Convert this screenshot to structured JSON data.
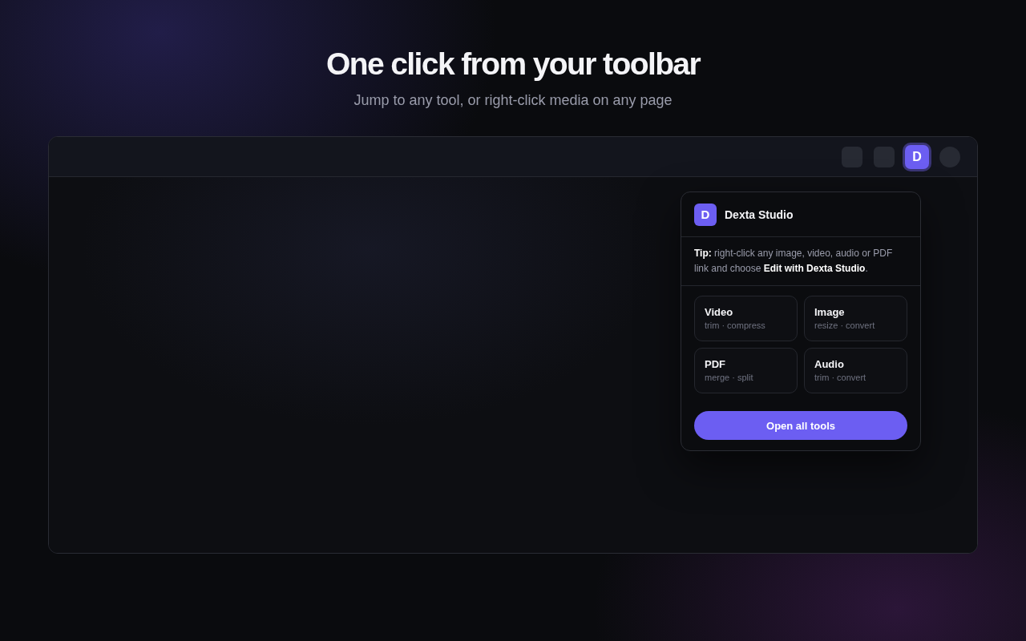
{
  "hero": {
    "title": "One click from your toolbar",
    "subtitle": "Jump to any tool, or right-click media on any page"
  },
  "browser": {
    "toolbar": [
      {
        "kind": "tile",
        "selected": false
      },
      {
        "kind": "tile",
        "selected": false
      },
      {
        "kind": "extension",
        "label": "D",
        "selected": true
      },
      {
        "kind": "avatar",
        "selected": false
      }
    ],
    "popup": {
      "logo": "D",
      "name": "Dexta Studio",
      "tip": "**Tip:** right-click any image, video, audio or PDF link and choose **Edit with Dexta Studio**.",
      "tools": [
        {
          "name": "Video",
          "actions": "trim · compress"
        },
        {
          "name": "Image",
          "actions": "resize · convert"
        },
        {
          "name": "PDF",
          "actions": "merge · split"
        },
        {
          "name": "Audio",
          "actions": "trim · convert"
        }
      ],
      "button": "Open all tools"
    }
  }
}
